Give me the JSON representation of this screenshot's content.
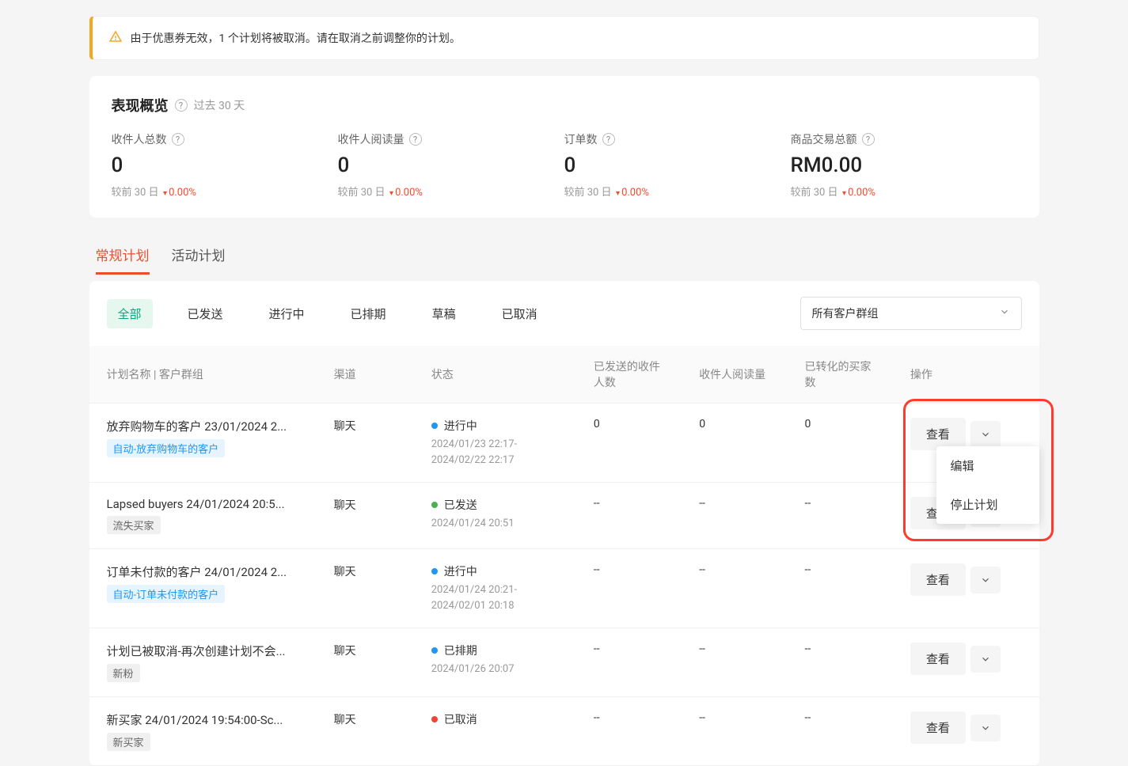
{
  "alert": {
    "text": "由于优惠券无效，1 个计划将被取消。请在取消之前调整你的计划。"
  },
  "overview": {
    "title": "表现概览",
    "subtitle": "过去 30 天",
    "metrics": [
      {
        "label": "收件人总数",
        "value": "0",
        "compare_prefix": "较前 30 日",
        "delta": "0.00%"
      },
      {
        "label": "收件人阅读量",
        "value": "0",
        "compare_prefix": "较前 30 日",
        "delta": "0.00%"
      },
      {
        "label": "订单数",
        "value": "0",
        "compare_prefix": "较前 30 日",
        "delta": "0.00%"
      },
      {
        "label": "商品交易总额",
        "value": "RM0.00",
        "compare_prefix": "较前 30 日",
        "delta": "0.00%"
      }
    ]
  },
  "main_tabs": [
    {
      "label": "常规计划",
      "active": true
    },
    {
      "label": "活动计划",
      "active": false
    }
  ],
  "filter_tabs": [
    {
      "label": "全部",
      "active": true
    },
    {
      "label": "已发送",
      "active": false
    },
    {
      "label": "进行中",
      "active": false
    },
    {
      "label": "已排期",
      "active": false
    },
    {
      "label": "草稿",
      "active": false
    },
    {
      "label": "已取消",
      "active": false
    }
  ],
  "group_select": {
    "selected": "所有客户群组"
  },
  "table": {
    "headers": {
      "name": "计划名称 | 客户群组",
      "channel": "渠道",
      "status": "状态",
      "sent": "已发送的收件人数",
      "read": "收件人阅读量",
      "converted": "已转化的买家数",
      "actions": "操作"
    },
    "rows": [
      {
        "name": "放弃购物车的客户 23/01/2024 2...",
        "tag": "自动-放弃购物车的客户",
        "tag_type": "blue",
        "channel": "聊天",
        "status_text": "进行中",
        "status_color": "blue",
        "date1": "2024/01/23 22:17-",
        "date2": "2024/02/22 22:17",
        "sent": "0",
        "read": "0",
        "converted": "0",
        "menu_open": true
      },
      {
        "name": "Lapsed buyers 24/01/2024 20:5...",
        "tag": "流失买家",
        "tag_type": "gray",
        "channel": "聊天",
        "status_text": "已发送",
        "status_color": "green",
        "date1": "2024/01/24 20:51",
        "date2": "",
        "sent": "--",
        "read": "--",
        "converted": "--",
        "menu_open": false
      },
      {
        "name": "订单未付款的客户 24/01/2024 2...",
        "tag": "自动-订单未付款的客户",
        "tag_type": "blue",
        "channel": "聊天",
        "status_text": "进行中",
        "status_color": "blue",
        "date1": "2024/01/24 20:21-",
        "date2": "2024/02/01 20:18",
        "sent": "--",
        "read": "--",
        "converted": "--",
        "menu_open": false
      },
      {
        "name": "计划已被取消-再次创建计划不会...",
        "tag": "新粉",
        "tag_type": "gray",
        "channel": "聊天",
        "status_text": "已排期",
        "status_color": "blue",
        "date1": "2024/01/26 20:07",
        "date2": "",
        "sent": "--",
        "read": "--",
        "converted": "--",
        "menu_open": false
      },
      {
        "name": "新买家 24/01/2024 19:54:00-Sc...",
        "tag": "新买家",
        "tag_type": "gray",
        "channel": "聊天",
        "status_text": "已取消",
        "status_color": "red",
        "date1": "",
        "date2": "",
        "sent": "--",
        "read": "--",
        "converted": "--",
        "menu_open": false
      }
    ]
  },
  "actions": {
    "view": "查看",
    "menu_items": [
      "编辑",
      "停止计划"
    ]
  }
}
